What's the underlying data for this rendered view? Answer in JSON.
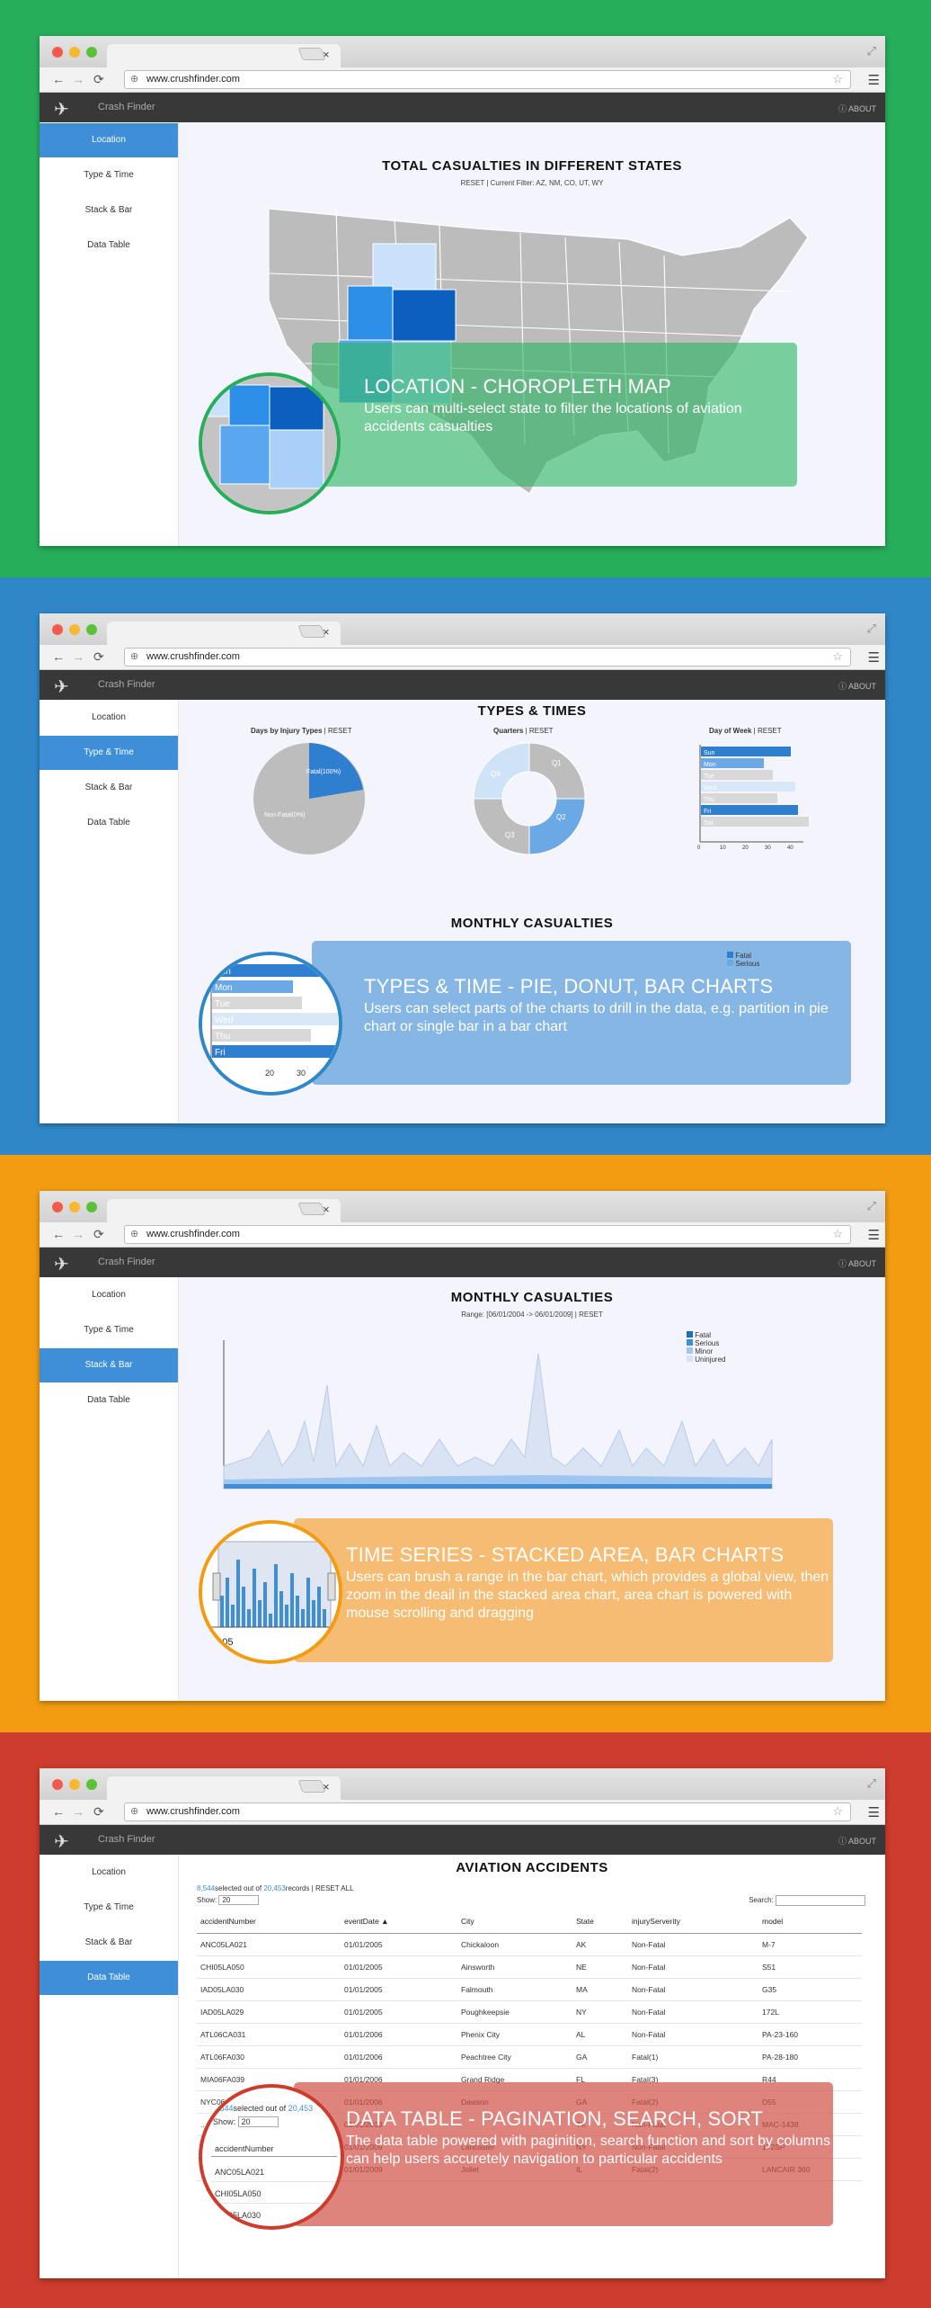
{
  "browser": {
    "url": "www.crushfinder.com",
    "tab_close": "×"
  },
  "app": {
    "title": "Crash Finder",
    "about": "ABOUT"
  },
  "sidebar": {
    "items": [
      {
        "label": "Location"
      },
      {
        "label": "Type & Time"
      },
      {
        "label": "Stack & Bar"
      },
      {
        "label": "Data Table"
      }
    ]
  },
  "panel1": {
    "title": "TOTAL CASUALTIES IN DIFFERENT STATES",
    "reset": "RESET",
    "filter": "| Current Filter: AZ, NM, CO, UT, WY",
    "overlay_title": "LOCATION - CHOROPLETH MAP",
    "overlay_desc": "Users can multi-select state to filter the locations of aviation accidents casualties"
  },
  "panel2": {
    "title": "TYPES & TIMES",
    "pie_title": "Days by Injury Types",
    "quarters_title": "Quarters",
    "dow_title": "Day of Week",
    "reset": "| RESET",
    "pie_fatal": "Fatal(100%)",
    "pie_nonfatal": "Non-Fatal(0%)",
    "q_labels": [
      "Q1",
      "Q2",
      "Q3",
      "Q4"
    ],
    "days": [
      "Sun",
      "Mon",
      "Tue",
      "Wed",
      "Thu",
      "Fri",
      "Sat"
    ],
    "dow_ticks": [
      "0",
      "10",
      "20",
      "30",
      "40"
    ],
    "monthly_title": "MONTHLY CASUALTIES",
    "legend": [
      "Fatal",
      "Serious"
    ],
    "mag_ticks": [
      "20",
      "30"
    ],
    "overlay_title": "TYPES & TIME - PIE, DONUT, BAR CHARTS",
    "overlay_desc": "Users can select parts of the charts to drill in the data, e.g. partition in pie chart or single bar in a bar chart"
  },
  "panel3": {
    "title": "MONTHLY CASUALTIES",
    "range": "Range: [06/01/2004 -> 06/01/2009] | RESET",
    "legend": [
      "Fatal",
      "Serious",
      "Minor",
      "Uninjured"
    ],
    "overlay_title": "TIME SERIES - STACKED AREA, BAR CHARTS",
    "overlay_desc": "Users can brush a range in the bar chart, which provides a global view, then zoom in the deail in the stacked area chart, area chart is powered with mouse scrolling and dragging",
    "mag_label": "2005"
  },
  "panel4": {
    "title": "AVIATION ACCIDENTS",
    "selected": "8,544",
    "selected_text": "selected out of",
    "total": "20,453",
    "records_text": "records | RESET ALL",
    "show_label": "Show:",
    "show_value": "20",
    "search_label": "Search:",
    "columns": [
      "accidentNumber",
      "eventDate ▲",
      "City",
      "State",
      "injuryServerity",
      "model"
    ],
    "rows": [
      [
        "ANC05LA021",
        "01/01/2005",
        "Chickaloon",
        "AK",
        "Non-Fatal",
        "M-7"
      ],
      [
        "CHI05LA050",
        "01/01/2005",
        "Ainsworth",
        "NE",
        "Non-Fatal",
        "S51"
      ],
      [
        "IAD05LA030",
        "01/01/2005",
        "Falmouth",
        "MA",
        "Non-Fatal",
        "G35"
      ],
      [
        "IAD05LA029",
        "01/01/2005",
        "Poughkeepsie",
        "NY",
        "Non-Fatal",
        "172L"
      ],
      [
        "ATL06CA031",
        "01/01/2006",
        "Phenix City",
        "AL",
        "Non-Fatal",
        "PA-23-160"
      ],
      [
        "ATL06FA030",
        "01/01/2006",
        "Peachtree City",
        "GA",
        "Fatal(1)",
        "PA-28-180"
      ],
      [
        "MIA06FA039",
        "01/01/2006",
        "Grand Ridge",
        "FL",
        "Fatal(3)",
        "R44"
      ],
      [
        "NYC06...",
        "01/01/2006",
        "Dawson",
        "GA",
        "Fatal(2)",
        "D55"
      ]
    ],
    "rows_bottom": [
      [
        "...",
        "01/01/2009",
        "",
        "TX",
        "Non-Fatal",
        "MAC-1438"
      ],
      [
        "ERA09...",
        "01/01/2009",
        "Lancaster",
        "NY",
        "Non-Fatal",
        "172SP"
      ],
      [
        "CEN09FA111",
        "01/01/2009",
        "Joliet",
        "IL",
        "Fatal(2)",
        "LANCAIR 360"
      ]
    ],
    "mag_selected": "8,544",
    "mag_total": "20,453",
    "mag_show": "Show:",
    "mag_show_value": "20",
    "mag_col": "accidentNumber",
    "mag_rows": [
      "ANC05LA021",
      "CHI05LA050",
      "IAD05LA030"
    ],
    "overlay_title": "DATA TABLE - PAGINATION, SEARCH, SORT",
    "overlay_desc": "The data table powered with paginition, search function and sort by columns can help users accuretely navigation to particular accidents"
  },
  "colors": {
    "green": "#27ae5a",
    "blue": "#2f87c8",
    "orange": "#f39c12",
    "red": "#cd3c2c",
    "accent": "#3e8fd8"
  }
}
